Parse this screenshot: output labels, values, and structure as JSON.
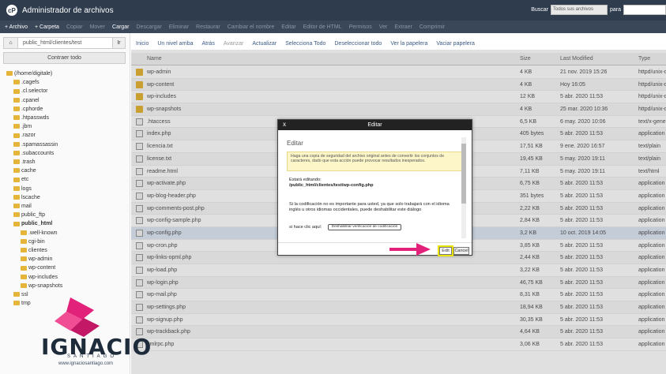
{
  "header": {
    "logo": "cP",
    "title": "Administrador de archivos",
    "search_label": "Buscar",
    "search_scope": "Todos sus archivos",
    "search_for": "para"
  },
  "toolbar1": [
    "+ Archivo",
    "+ Carpeta",
    "Copiar",
    "Mover",
    "Cargar",
    "Descargar",
    "Eliminar",
    "Restaurar",
    "Cambiar el nombre",
    "Editar",
    "Editor de HTML",
    "Permisos",
    "Ver",
    "Extraer",
    "Comprimir"
  ],
  "sidebar": {
    "path": "public_html/clientes/test",
    "go": "Ir",
    "collapse": "Contraer todo",
    "tree": [
      {
        "t": "(/home/digitale)",
        "d": 0,
        "b": false
      },
      {
        "t": ".cagefs",
        "d": 1,
        "b": false
      },
      {
        "t": ".cl.selector",
        "d": 1,
        "b": false
      },
      {
        "t": ".cpanel",
        "d": 1,
        "b": false
      },
      {
        "t": ".cphorde",
        "d": 1,
        "b": false
      },
      {
        "t": ".htpasswds",
        "d": 1,
        "b": false
      },
      {
        "t": ".jbm",
        "d": 1,
        "b": false
      },
      {
        "t": ".razor",
        "d": 1,
        "b": false
      },
      {
        "t": ".spamassassin",
        "d": 1,
        "b": false
      },
      {
        "t": ".subaccounts",
        "d": 1,
        "b": false
      },
      {
        "t": ".trash",
        "d": 1,
        "b": false
      },
      {
        "t": "cache",
        "d": 1,
        "b": false
      },
      {
        "t": "etc",
        "d": 1,
        "b": false
      },
      {
        "t": "logs",
        "d": 1,
        "b": false
      },
      {
        "t": "lscache",
        "d": 1,
        "b": false
      },
      {
        "t": "mail",
        "d": 1,
        "b": false
      },
      {
        "t": "public_ftp",
        "d": 1,
        "b": false
      },
      {
        "t": "public_html",
        "d": 1,
        "b": true
      },
      {
        "t": ".well-known",
        "d": 2,
        "b": false
      },
      {
        "t": "cgi-bin",
        "d": 2,
        "b": false
      },
      {
        "t": "clientes",
        "d": 2,
        "b": false
      },
      {
        "t": "wp-admin",
        "d": 2,
        "b": false
      },
      {
        "t": "wp-content",
        "d": 2,
        "b": false
      },
      {
        "t": "wp-includes",
        "d": 2,
        "b": false
      },
      {
        "t": "wp-snapshots",
        "d": 2,
        "b": false
      },
      {
        "t": "ssl",
        "d": 1,
        "b": false
      },
      {
        "t": "tmp",
        "d": 1,
        "b": false
      }
    ]
  },
  "toolbar2": [
    "Inicio",
    "Un nivel arriba",
    "Atrás",
    "Avanzar",
    "Actualizar",
    "Selecciona Todo",
    "Deseleccionar todo",
    "Ver la papelera",
    "Vaciar papelera"
  ],
  "table": {
    "headers": [
      "Name",
      "Size",
      "Last Modified",
      "Type"
    ],
    "rows": [
      {
        "n": "wp-admin",
        "s": "4 KB",
        "m": "21 nov. 2019 15:26",
        "t": "httpd/unix-d",
        "f": true
      },
      {
        "n": "wp-content",
        "s": "4 KB",
        "m": "Hoy 16:05",
        "t": "httpd/unix-d",
        "f": true
      },
      {
        "n": "wp-includes",
        "s": "12 KB",
        "m": "5 abr. 2020 11:53",
        "t": "httpd/unix-d",
        "f": true
      },
      {
        "n": "wp-snapshots",
        "s": "4 KB",
        "m": "25 mar. 2020 10:36",
        "t": "httpd/unix-d",
        "f": true
      },
      {
        "n": ".htaccess",
        "s": "6,5 KB",
        "m": "6 may. 2020 10:06",
        "t": "text/x-gene",
        "f": false
      },
      {
        "n": "index.php",
        "s": "405 bytes",
        "m": "5 abr. 2020 11:53",
        "t": "application",
        "f": false
      },
      {
        "n": "licencia.txt",
        "s": "17,51 KB",
        "m": "9 ene. 2020 16:57",
        "t": "text/plain",
        "f": false
      },
      {
        "n": "license.txt",
        "s": "19,45 KB",
        "m": "5 may. 2020 19:11",
        "t": "text/plain",
        "f": false
      },
      {
        "n": "readme.html",
        "s": "7,11 KB",
        "m": "5 may. 2020 19:11",
        "t": "text/html",
        "f": false
      },
      {
        "n": "wp-activate.php",
        "s": "6,75 KB",
        "m": "5 abr. 2020 11:53",
        "t": "application",
        "f": false
      },
      {
        "n": "wp-blog-header.php",
        "s": "351 bytes",
        "m": "5 abr. 2020 11:53",
        "t": "application",
        "f": false
      },
      {
        "n": "wp-comments-post.php",
        "s": "2,22 KB",
        "m": "5 abr. 2020 11:53",
        "t": "application",
        "f": false
      },
      {
        "n": "wp-config-sample.php",
        "s": "2,84 KB",
        "m": "5 abr. 2020 11:53",
        "t": "application",
        "f": false
      },
      {
        "n": "wp-config.php",
        "s": "3,2 KB",
        "m": "10 oct. 2019 14:05",
        "t": "application",
        "f": false,
        "sel": true
      },
      {
        "n": "wp-cron.php",
        "s": "3,85 KB",
        "m": "5 abr. 2020 11:53",
        "t": "application",
        "f": false
      },
      {
        "n": "wp-links-opml.php",
        "s": "2,44 KB",
        "m": "5 abr. 2020 11:53",
        "t": "application",
        "f": false
      },
      {
        "n": "wp-load.php",
        "s": "3,22 KB",
        "m": "5 abr. 2020 11:53",
        "t": "application",
        "f": false
      },
      {
        "n": "wp-login.php",
        "s": "46,75 KB",
        "m": "5 abr. 2020 11:53",
        "t": "application",
        "f": false
      },
      {
        "n": "wp-mail.php",
        "s": "8,31 KB",
        "m": "5 abr. 2020 11:53",
        "t": "application",
        "f": false
      },
      {
        "n": "wp-settings.php",
        "s": "18,94 KB",
        "m": "5 abr. 2020 11:53",
        "t": "application",
        "f": false
      },
      {
        "n": "wp-signup.php",
        "s": "30,35 KB",
        "m": "5 abr. 2020 11:53",
        "t": "application",
        "f": false
      },
      {
        "n": "wp-trackback.php",
        "s": "4,64 KB",
        "m": "5 abr. 2020 11:53",
        "t": "application",
        "f": false
      },
      {
        "n": "xmlrpc.php",
        "s": "3,06 KB",
        "m": "5 abr. 2020 11:53",
        "t": "application",
        "f": false
      }
    ]
  },
  "dialog": {
    "title": "Editar",
    "close": "x",
    "heading": "Editar",
    "warning": "Haga una copia de seguridad del archivo original antes de convertir los conjuntos de caracteres, dado que esta acción puede provocar resultados inesperados.",
    "editing_label": "Estará editando:",
    "editing_path": "/public_html/clientes/test/wp-config.php",
    "encoding_note": "Si la codificación no es importante para usted, ya que solo trabajará con el idioma inglés u otros idiomas occidentales, puede deshabilitar este diálogo",
    "click_here": "si hace clic aquí:",
    "disable_button": "Deshabilitar verificación de codificación",
    "edit_button": "Edit",
    "cancel_button": "Cancel"
  },
  "brand": {
    "name": "IGNACIO",
    "sub": "SANTIAGO",
    "url": "www.ignaciosantiago.com",
    "color": "#e2217a"
  }
}
